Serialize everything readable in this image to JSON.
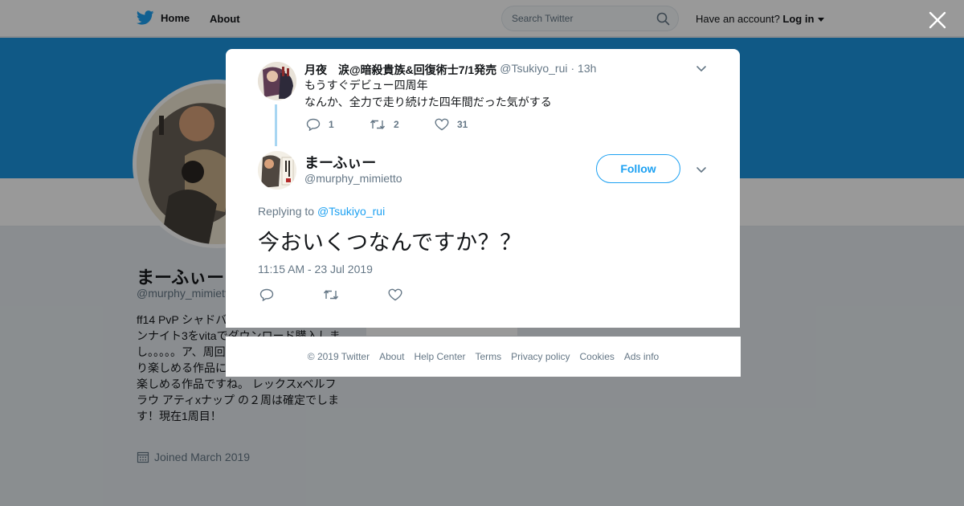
{
  "topbar": {
    "home_label": "Home",
    "about_label": "About",
    "search_placeholder": "Search Twitter",
    "account_prompt": "Have an account?",
    "login_label": "Log in"
  },
  "profile": {
    "name": "まーふぃー",
    "handle": "@murphy_mimiett",
    "bio": "ff14 PvP シャドバ。。。。。い。 近況、サモンナイト3をvitaでダウンロード購入しまし。。。。。ア、周回した作品。。。。。れ、より楽しめる作品に仕上がってて まだまだ楽しめる作品ですね。 レックスxベルフラウ アティxナップ の２周は確定でします！現在1周目！",
    "joined": "Joined March 2019"
  },
  "parent_tweet": {
    "name": "月夜　涙@暗殺貴族&回復術士7/1発売",
    "handle": "@Tsukiyo_rui",
    "time": "· 13h",
    "line1": "もうすぐデビュー四周年",
    "line2": "なんか、全力で走り続けた四年間だった気がする",
    "replies": "1",
    "retweets": "2",
    "likes": "31"
  },
  "main_tweet": {
    "name": "まーふぃー",
    "handle": "@murphy_mimietto",
    "follow_label": "Follow",
    "replying_prefix": "Replying to",
    "replying_handle": "@Tsukiyo_rui",
    "text": "今おいくつなんですか？？",
    "timestamp": "11:15 AM - 23 Jul 2019"
  },
  "footer": {
    "copyright": "© 2019 Twitter",
    "about": "About",
    "help": "Help Center",
    "terms": "Terms",
    "privacy": "Privacy policy",
    "cookies": "Cookies",
    "ads": "Ads info"
  },
  "colors": {
    "brand": "#1da1f2",
    "banner": "#1b95e0",
    "thread_line": "#a8d6f2",
    "muted_text": "#657786"
  },
  "icons": [
    "twitter-bird-icon",
    "search-icon",
    "caret-down-icon",
    "close-icon",
    "reply-icon",
    "retweet-icon",
    "heart-icon",
    "calendar-icon",
    "chevron-down-icon"
  ]
}
